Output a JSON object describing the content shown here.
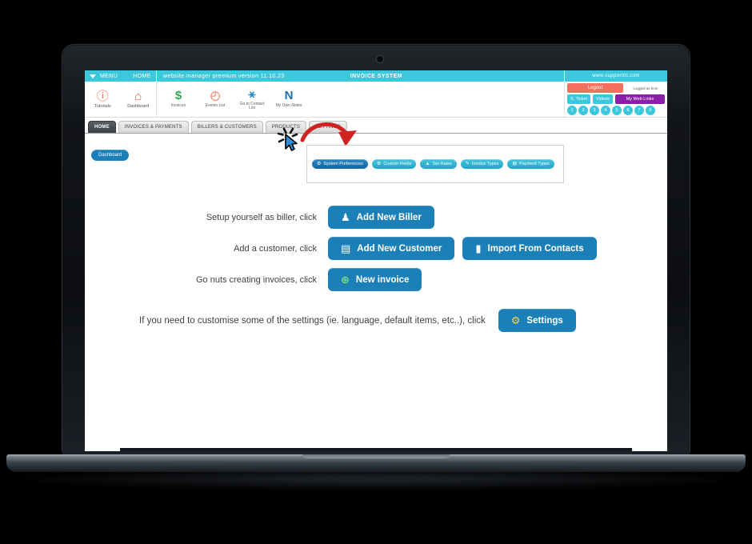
{
  "window": {
    "device": "laptop",
    "webcam_label": "webcam"
  },
  "app_bar": {
    "menu_label": "MENU",
    "home_label": "HOME",
    "version_text": "website manager premium version 11.10.23",
    "system_title": "INVOICE SYSTEM",
    "site_url": "www.supportttt.com"
  },
  "header": {
    "left_icons": [
      {
        "icon": "info-circle-icon",
        "glyph": "ⓘ",
        "label": "Tutorials",
        "color": "#e8603c"
      },
      {
        "icon": "home-icon",
        "glyph": "⌂",
        "label": "Dashboard",
        "color": "#e8603c"
      }
    ],
    "mid_icons": [
      {
        "icon": "dollar-icon",
        "glyph": "$",
        "label": "Invoices",
        "color": "#2fa84f"
      },
      {
        "icon": "clock-icon",
        "glyph": "◴",
        "label": "Events List",
        "color": "#e8603c"
      },
      {
        "icon": "person-icon",
        "glyph": "⚹",
        "label": "Go to Contact List",
        "color": "#2a86c4"
      },
      {
        "icon": "letter-n-icon",
        "glyph": "N",
        "label": "My Own Notes",
        "color": "#1b6fae"
      }
    ],
    "account": {
      "logout_label": "Logout",
      "logged_as_label": "Logged as bum",
      "support_ticket_label": "S. Ticket",
      "videos_label": "Videos",
      "web_links_label": "My Web Links",
      "numbers": [
        "1",
        "2",
        "3",
        "4",
        "5",
        "6",
        "7",
        "8"
      ],
      "logout_color": "#f4715f",
      "teal_color": "#3cc8dc",
      "purple_color": "#8b1fa9"
    }
  },
  "tabs": [
    {
      "label": "HOME",
      "active": true
    },
    {
      "label": "INVOICES & PAYMENTS",
      "active": false
    },
    {
      "label": "BILLERS & CUSTOMERS",
      "active": false
    },
    {
      "label": "PRODUCTS",
      "active": false
    },
    {
      "label": "SETTINGS",
      "active": false
    }
  ],
  "content": {
    "dashboard_button": "Dashboard",
    "submenu": [
      {
        "label": "System Preferences",
        "icon": "puzzle-icon",
        "glyph": "⚙",
        "style": "dark"
      },
      {
        "label": "Custom Fields",
        "icon": "puzzle-icon",
        "glyph": "⚙",
        "style": "light"
      },
      {
        "label": "Tax Rates",
        "icon": "percent-icon",
        "glyph": "▲",
        "style": "light"
      },
      {
        "label": "Invoice Types",
        "icon": "edit-note-icon",
        "glyph": "✎",
        "style": "light"
      },
      {
        "label": "Payment Types",
        "icon": "cards-icon",
        "glyph": "▤",
        "style": "light"
      }
    ],
    "rows": [
      {
        "label": "Setup yourself as biller, click",
        "buttons": [
          {
            "label": "Add New Biller",
            "icon": "add-user-icon",
            "glyph": "♟"
          }
        ]
      },
      {
        "label": "Add a customer, click",
        "buttons": [
          {
            "label": "Add New Customer",
            "icon": "add-contact-card-icon",
            "glyph": "▤"
          },
          {
            "label": "Import From Contacts",
            "icon": "contacts-book-icon",
            "glyph": "▮"
          }
        ]
      },
      {
        "label": "Go nuts creating invoices, click",
        "buttons": [
          {
            "label": "New invoice",
            "icon": "plus-circle-icon",
            "glyph": "⊕"
          }
        ]
      }
    ],
    "settings_text": "If you need to customise some of the settings (ie. language, default items, etc..), click",
    "settings_button": {
      "label": "Settings",
      "icon": "gears-icon",
      "glyph": "⚙"
    }
  },
  "annotations": {
    "cursor": "click-cursor-on-settings-tab",
    "arrow": "red-curved-arrow-to-submenu"
  },
  "colors": {
    "app_bar_teal": "#3cc8dc",
    "primary_blue": "#1b7fb8",
    "accent_orange": "#e8603c",
    "arrow_red": "#cf2222"
  }
}
